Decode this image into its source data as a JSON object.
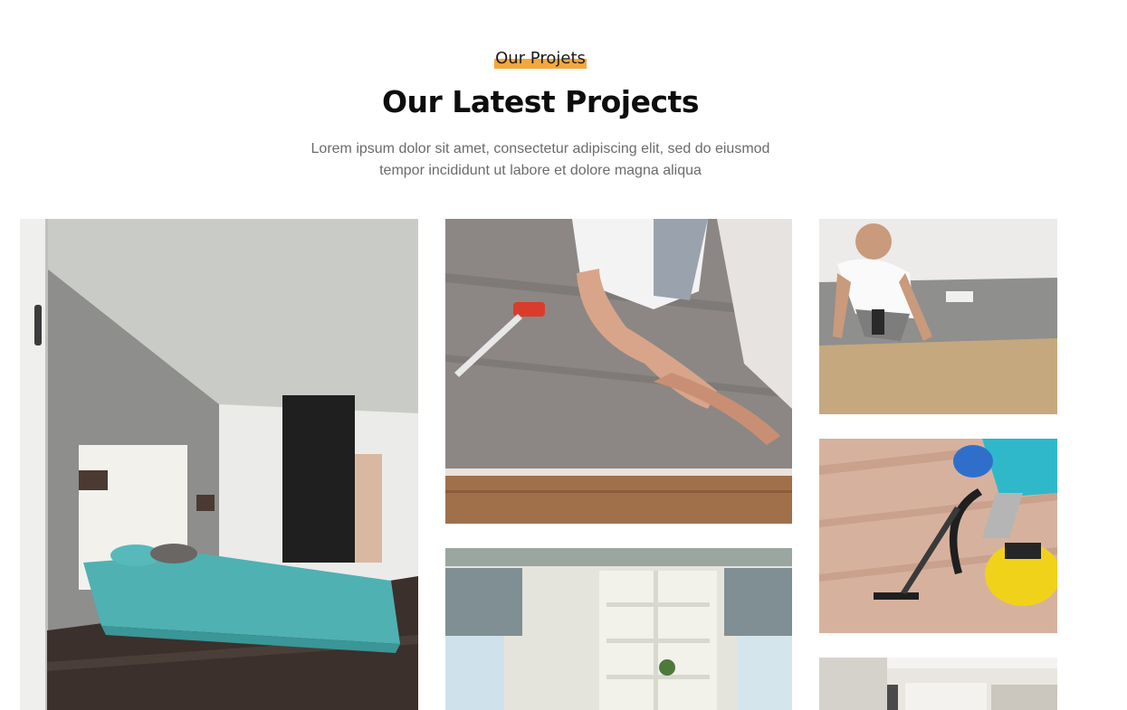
{
  "section": {
    "eyebrow": "Our Projets",
    "accent_color": "#f4a73d",
    "title": "Our Latest Projects",
    "description_line1": "Lorem ipsum dolor sit amet, consectetur adipiscing elit, sed do eiusmod",
    "description_line2": "tempor incididunt ut labore et dolore magna aliqua"
  },
  "gallery": {
    "images": [
      {
        "subject": "bedroom-with-turquoise-bedspread"
      },
      {
        "subject": "worker-laying-vinyl-floor-planks"
      },
      {
        "subject": "worker-kneeling-installing-floor"
      },
      {
        "subject": "worker-vacuuming-wood-floor"
      },
      {
        "subject": "room-with-built-in-shelves"
      },
      {
        "subject": "interior-ceiling-with-curtains"
      }
    ]
  }
}
